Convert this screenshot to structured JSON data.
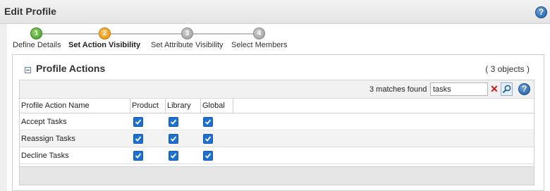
{
  "window": {
    "title": "Edit Profile"
  },
  "wizard": {
    "steps": [
      {
        "number": "1",
        "label": "Define Details",
        "state": "done"
      },
      {
        "number": "2",
        "label": "Set Action Visibility",
        "state": "active"
      },
      {
        "number": "3",
        "label": "Set Attribute Visibility",
        "state": "pending"
      },
      {
        "number": "4",
        "label": "Select Members",
        "state": "pending"
      }
    ]
  },
  "panel": {
    "title": "Profile Actions",
    "count": "( 3 objects )"
  },
  "grid": {
    "matches_text": "3 matches found",
    "search_value": "tasks",
    "columns": [
      "Profile Action Name",
      "Product",
      "Library",
      "Global"
    ],
    "rows": [
      {
        "name": "Accept Tasks",
        "product": true,
        "library": true,
        "global": true
      },
      {
        "name": "Reassign Tasks",
        "product": true,
        "library": true,
        "global": true
      },
      {
        "name": "Decline Tasks",
        "product": true,
        "library": true,
        "global": true
      }
    ]
  },
  "colors": {
    "accent": "#1d6fd1",
    "step_done": "#3c9b1e",
    "step_active": "#f08d00",
    "step_pending": "#9a9a9a"
  },
  "icons": {
    "help": "help-icon",
    "collapse": "collapse-icon",
    "clear": "clear-search-icon",
    "search": "search-icon",
    "checkbox": "checkbox-checked-icon"
  }
}
